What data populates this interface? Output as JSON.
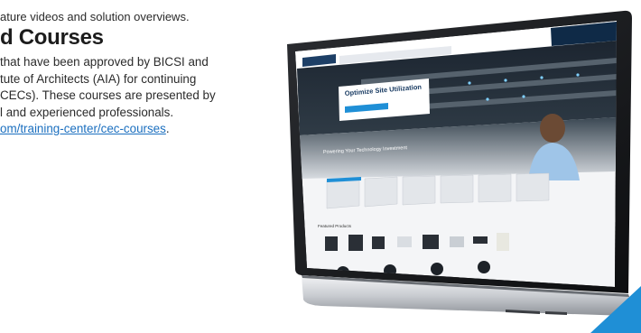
{
  "text": {
    "intro_line": "ature videos and solution overviews.",
    "heading": "d Courses",
    "body_lines": [
      "that have been approved by BICSI and",
      "tute of Architects (AIA) for continuing",
      "CECs). These courses are presented by",
      "l and experienced professionals."
    ],
    "link": "om/training-center/cec-courses",
    "link_suffix": "."
  },
  "screen": {
    "hero_title": "Optimize Site Utilization",
    "hero_button": "",
    "investment_banner": "Powering Your Technology Investment",
    "featured_products": "Featured Products"
  },
  "colors": {
    "accent": "#1f8fd6",
    "link": "#1b6fbf",
    "screen_nav": "#0f2a47"
  }
}
